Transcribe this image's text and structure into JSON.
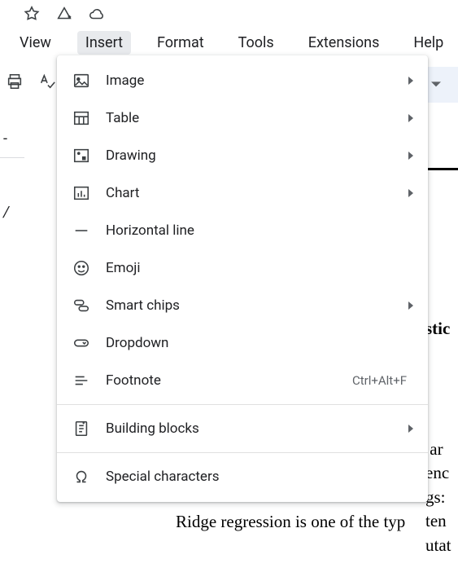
{
  "top_icons": [
    "star-icon",
    "version-add-icon",
    "cloud-icon"
  ],
  "menu": {
    "items": [
      {
        "label": "View",
        "active": false
      },
      {
        "label": "Insert",
        "active": true
      },
      {
        "label": "Format",
        "active": false
      },
      {
        "label": "Tools",
        "active": false
      },
      {
        "label": "Extensions",
        "active": false
      },
      {
        "label": "Help",
        "active": false
      }
    ]
  },
  "toolbar": {
    "icons": [
      "print-icon",
      "spellcheck-icon"
    ]
  },
  "dropdown": {
    "groups": [
      [
        {
          "icon": "image-icon",
          "label": "Image",
          "submenu": true
        },
        {
          "icon": "table-icon",
          "label": "Table",
          "submenu": true
        },
        {
          "icon": "drawing-icon",
          "label": "Drawing",
          "submenu": true
        },
        {
          "icon": "chart-icon",
          "label": "Chart",
          "submenu": true
        },
        {
          "icon": "hline-icon",
          "label": "Horizontal line"
        },
        {
          "icon": "emoji-icon",
          "label": "Emoji"
        },
        {
          "icon": "smartchips-icon",
          "label": "Smart chips",
          "submenu": true
        },
        {
          "icon": "dropdown-icon",
          "label": "Dropdown"
        },
        {
          "icon": "footnote-icon",
          "label": "Footnote",
          "shortcut": "Ctrl+Alt+F"
        }
      ],
      [
        {
          "icon": "buildingblocks-icon",
          "label": "Building blocks",
          "submenu": true
        }
      ],
      [
        {
          "icon": "omega-icon",
          "label": "Special characters"
        }
      ]
    ]
  },
  "background": {
    "side_dash": "-",
    "side_slash": "/",
    "bold_frag": "stic",
    "lines": " ar\nenc\ngs:\nten\nutat",
    "bottom": "Ridge regression is one of the typ"
  }
}
